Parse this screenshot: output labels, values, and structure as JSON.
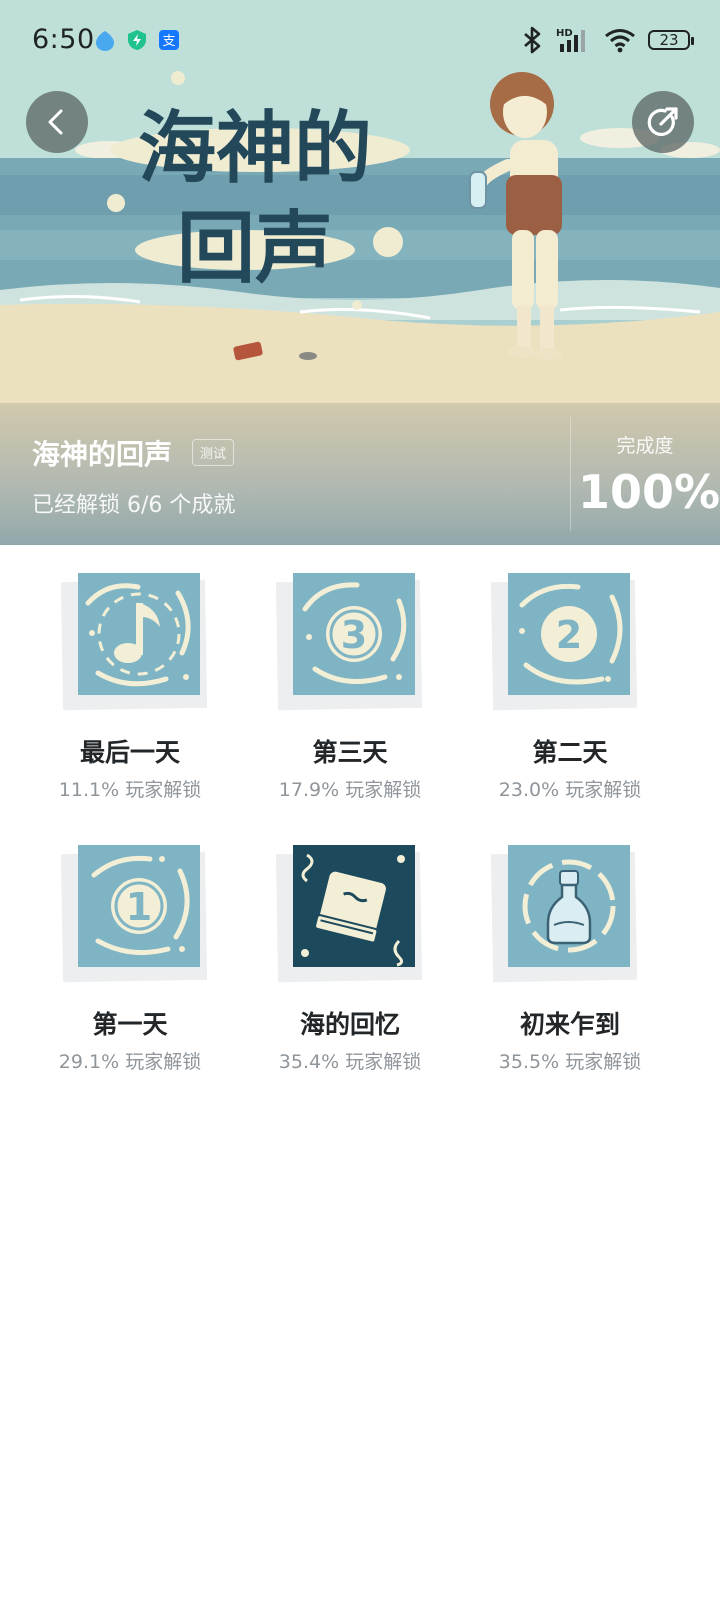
{
  "status_bar": {
    "time": "6:50",
    "app_icons": [
      "blue-drop-icon",
      "green-shield-icon",
      "alipay-icon"
    ],
    "right_icons": [
      "bluetooth-icon",
      "hd-signal-icon",
      "wifi-icon"
    ],
    "battery": "23",
    "network_label": "HD"
  },
  "hero": {
    "artwork_title_line1": "海神的",
    "artwork_title_line2": "回声"
  },
  "game": {
    "title": "海神的回声",
    "badge": "测试",
    "unlock_summary": "已经解锁 6/6 个成就",
    "completion_label": "完成度",
    "completion_value": "100%"
  },
  "achievements": [
    {
      "name": "最后一天",
      "rate": "11.1% 玩家解锁",
      "icon": "music-note-icon"
    },
    {
      "name": "第三天",
      "rate": "17.9% 玩家解锁",
      "icon": "number-three-icon"
    },
    {
      "name": "第二天",
      "rate": "23.0% 玩家解锁",
      "icon": "number-two-icon"
    },
    {
      "name": "第一天",
      "rate": "29.1% 玩家解锁",
      "icon": "number-one-icon"
    },
    {
      "name": "海的回忆",
      "rate": "35.4% 玩家解锁",
      "icon": "book-icon"
    },
    {
      "name": "初来乍到",
      "rate": "35.5% 玩家解锁",
      "icon": "bottle-icon"
    }
  ],
  "colors": {
    "icon_teal": "#7fb4c4",
    "icon_cream": "#f3efd6",
    "icon_dark": "#1c4a5c",
    "title_text": "#222629",
    "rate_text": "#8f959a"
  }
}
